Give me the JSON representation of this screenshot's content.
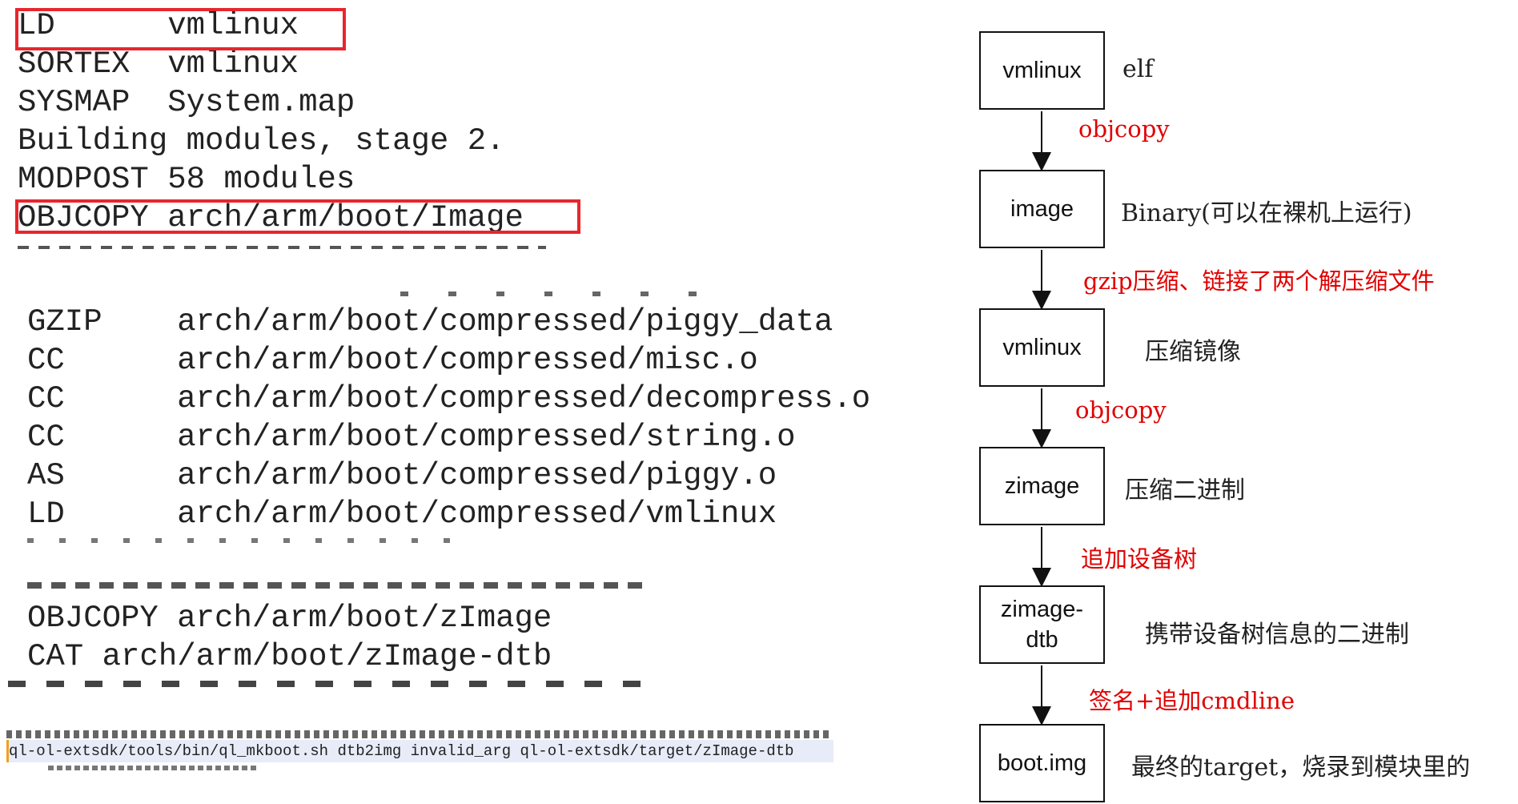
{
  "build_log_top": [
    {
      "cmd": "LD",
      "arg": "vmlinux",
      "highlighted": true
    },
    {
      "cmd": "SORTEX",
      "arg": "vmlinux",
      "highlighted": false
    },
    {
      "cmd": "SYSMAP",
      "arg": "System.map",
      "highlighted": false
    },
    {
      "cmd": "Building modules, stage 2.",
      "arg": "",
      "highlighted": false
    },
    {
      "cmd": "MODPOST 58 modules",
      "arg": "",
      "highlighted": false
    },
    {
      "cmd": "OBJCOPY",
      "arg": "arch/arm/boot/Image",
      "highlighted": true
    }
  ],
  "build_log_mid": [
    {
      "cmd": "GZIP",
      "arg": "arch/arm/boot/compressed/piggy_data"
    },
    {
      "cmd": "CC",
      "arg": "arch/arm/boot/compressed/misc.o"
    },
    {
      "cmd": "CC",
      "arg": "arch/arm/boot/compressed/decompress.o"
    },
    {
      "cmd": "CC",
      "arg": "arch/arm/boot/compressed/string.o"
    },
    {
      "cmd": "AS",
      "arg": "arch/arm/boot/compressed/piggy.o"
    },
    {
      "cmd": "LD",
      "arg": "arch/arm/boot/compressed/vmlinux"
    }
  ],
  "build_log_bottom": [
    {
      "cmd": "OBJCOPY",
      "arg": "arch/arm/boot/zImage"
    },
    {
      "cmd": "CAT",
      "arg": "arch/arm/boot/zImage-dtb"
    }
  ],
  "shell_line": "ql-ol-extsdk/tools/bin/ql_mkboot.sh dtb2img invalid_arg ql-ol-extsdk/target/zImage-dtb",
  "flow": {
    "nodes": [
      {
        "label": "vmlinux",
        "desc": "elf"
      },
      {
        "label": "image",
        "desc": "Binary(可以在裸机上运行)"
      },
      {
        "label": "vmlinux",
        "desc": "压缩镜像"
      },
      {
        "label": "zimage",
        "desc": "压缩二进制"
      },
      {
        "label": "zimage-\ndtb",
        "desc": "携带设备树信息的二进制"
      },
      {
        "label": "boot.img",
        "desc": "最终的target，烧录到模块里的"
      }
    ],
    "steps": [
      "objcopy",
      "gzip压缩、链接了两个解压缩文件",
      "objcopy",
      "追加设备树",
      "签名+追加cmdline"
    ]
  },
  "colors": {
    "highlight": "#e8262d",
    "step_text": "#e00000"
  }
}
